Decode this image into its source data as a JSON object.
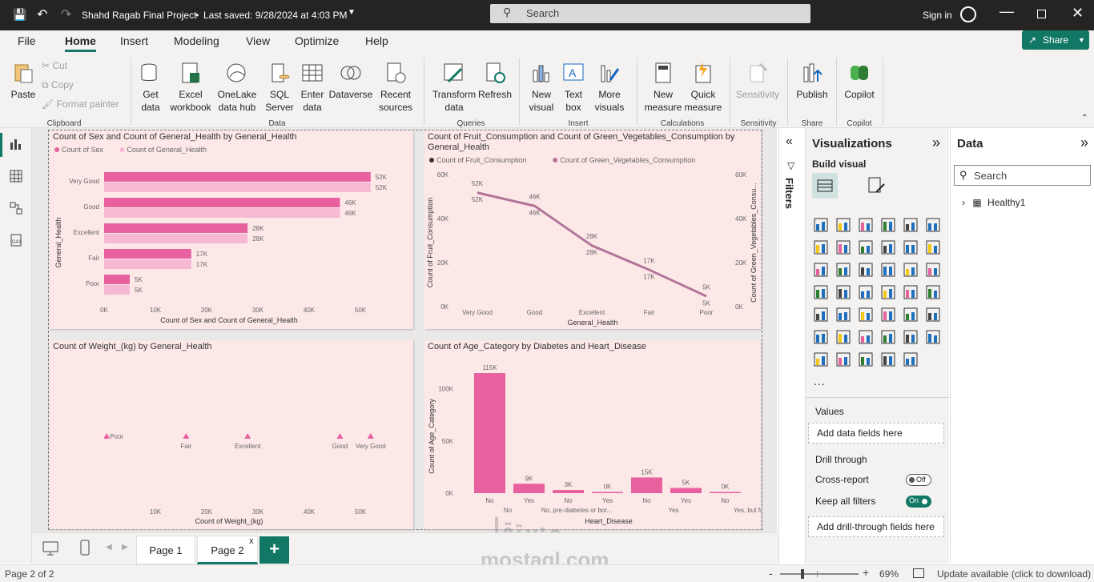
{
  "titlebar": {
    "file_title": "Shahd Ragab Final Project",
    "saved": "Last saved: 9/28/2024 at 4:03 PM",
    "search_placeholder": "Search",
    "sign_in": "Sign in"
  },
  "ribbon_tabs": [
    "File",
    "Home",
    "Insert",
    "Modeling",
    "View",
    "Optimize",
    "Help"
  ],
  "share_label": "Share",
  "clipboard": {
    "paste": "Paste",
    "cut": "Cut",
    "copy": "Copy",
    "format_painter": "Format painter",
    "group": "Clipboard"
  },
  "data_group": {
    "get_data": "Get data",
    "excel": "Excel workbook",
    "onelake": "OneLake data hub",
    "sql": "SQL Server",
    "enter": "Enter data",
    "dataverse": "Dataverse",
    "recent": "Recent sources",
    "group": "Data"
  },
  "queries": {
    "transform": "Transform data",
    "refresh": "Refresh",
    "group": "Queries"
  },
  "insert": {
    "new_visual": "New visual",
    "text_box": "Text box",
    "more_visuals": "More visuals",
    "group": "Insert"
  },
  "calculations": {
    "new_measure": "New measure",
    "quick_measure": "Quick measure",
    "group": "Calculations"
  },
  "sensitivity": {
    "label": "Sensitivity",
    "group": "Sensitivity"
  },
  "share_group": {
    "publish": "Publish",
    "group": "Share"
  },
  "copilot": {
    "label": "Copilot",
    "group": "Copilot"
  },
  "filters_label": "Filters",
  "viz_pane": {
    "title": "Visualizations",
    "build": "Build visual",
    "values": "Values",
    "add_fields": "Add data fields here",
    "drill": "Drill through",
    "cross_report": "Cross-report",
    "cross_state": "Off",
    "keep_filters": "Keep all filters",
    "keep_state": "On",
    "add_drill": "Add drill-through fields here",
    "more": "..."
  },
  "data_pane": {
    "title": "Data",
    "search_placeholder": "Search",
    "table": "Healthy1"
  },
  "pages": {
    "page1": "Page 1",
    "page2": "Page 2",
    "add": "+",
    "close": "x"
  },
  "status": {
    "page": "Page 2 of 2",
    "zoom": "69%",
    "update": "Update available (click to download)",
    "minus": "-",
    "plus": "+"
  },
  "watermark": {
    "logo": "مستقل",
    "site": "mostaql.com"
  },
  "colors": {
    "dark": "#e8619f",
    "light": "#f7b8d4",
    "line": "#b4749a",
    "teal": "#117865",
    "panel": "#fde8e8"
  },
  "chart_data": [
    {
      "type": "bar",
      "title": "Count of Sex and Count of General_Health by General_Health",
      "legend": [
        "Count of Sex",
        "Count of General_Health"
      ],
      "categories": [
        "Very Good",
        "Good",
        "Excellent",
        "Fair",
        "Poor"
      ],
      "series": [
        {
          "name": "Count of Sex",
          "values": [
            52,
            46,
            28,
            17,
            5
          ]
        },
        {
          "name": "Count of General_Health",
          "values": [
            52,
            46,
            28,
            17,
            5
          ]
        }
      ],
      "labels": [
        "52K",
        "46K",
        "28K",
        "17K",
        "5K"
      ],
      "xticks": [
        "0K",
        "10K",
        "20K",
        "30K",
        "40K",
        "50K"
      ],
      "xlim": [
        0,
        55
      ],
      "xlabel": "Count of Sex and Count of General_Health",
      "ylabel": "General_Health"
    },
    {
      "type": "line",
      "title": "Count of Fruit_Consumption and Count of Green_Vegetables_Consumption by General_Health",
      "legend": [
        "Count of Fruit_Consumption",
        "Count of Green_Vegetables_Consumption"
      ],
      "categories": [
        "Very Good",
        "Good",
        "Excellent",
        "Fair",
        "Poor"
      ],
      "series": [
        {
          "name": "Count of Fruit_Consumption",
          "values": [
            52,
            46,
            28,
            17,
            5
          ]
        },
        {
          "name": "Count of Green_Vegetables_Consumption",
          "values": [
            52,
            46,
            28,
            17,
            5
          ]
        }
      ],
      "labels": [
        "52K",
        "46K",
        "28K",
        "17K",
        "5K"
      ],
      "yticks": [
        "0K",
        "20K",
        "40K",
        "60K"
      ],
      "ylim": [
        0,
        60
      ],
      "xlabel": "General_Health",
      "ylabel": "Count of Fruit_Consumption",
      "ylabel2": "Count of Green_Vegetables_Consu..."
    },
    {
      "type": "scatter",
      "title": "Count of Weight_(kg) by General_Health",
      "points": [
        {
          "label": "Poor",
          "x": 0.5
        },
        {
          "label": "Fair",
          "x": 16
        },
        {
          "label": "Excellent",
          "x": 28
        },
        {
          "label": "Good",
          "x": 46
        },
        {
          "label": "Very Good",
          "x": 52
        }
      ],
      "xticks": [
        "10K",
        "20K",
        "30K",
        "40K",
        "50K"
      ],
      "xlim": [
        0,
        55
      ],
      "xlabel": "Count of Weight_(kg)"
    },
    {
      "type": "bar",
      "title": "Count of Age_Category by Diabetes and Heart_Disease",
      "values": [
        115,
        9,
        3,
        0,
        15,
        5,
        0
      ],
      "labels": [
        "115K",
        "9K",
        "3K",
        "0K",
        "15K",
        "5K",
        "0K"
      ],
      "heart": [
        "No",
        "Yes",
        "No",
        "Yes",
        "No",
        "Yes",
        "No"
      ],
      "diabetes": [
        "No",
        "No, pre-diabetes or bor...",
        "Yes",
        "Yes, but fe..."
      ],
      "yticks": [
        "0K",
        "50K",
        "100K"
      ],
      "ylim": [
        0,
        125
      ],
      "xlabel": "Heart_Disease",
      "ylabel": "Count of Age_Category"
    }
  ]
}
